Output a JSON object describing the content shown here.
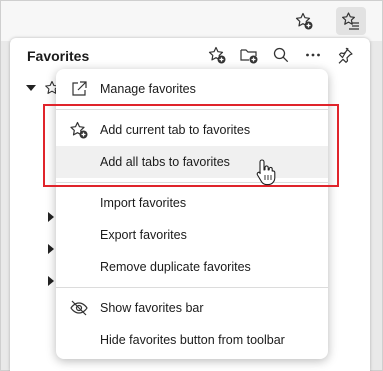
{
  "panel": {
    "title": "Favorites"
  },
  "menu": {
    "items": [
      {
        "label": "Manage favorites",
        "icon": "external-link-icon"
      },
      {
        "label": "Add current tab to favorites",
        "icon": "star-add-icon"
      },
      {
        "label": "Add all tabs to favorites",
        "icon": ""
      },
      {
        "label": "Import favorites",
        "icon": ""
      },
      {
        "label": "Export favorites",
        "icon": ""
      },
      {
        "label": "Remove duplicate favorites",
        "icon": ""
      },
      {
        "label": "Show favorites bar",
        "icon": "eye-off-icon"
      },
      {
        "label": "Hide favorites button from toolbar",
        "icon": ""
      }
    ]
  },
  "colors": {
    "highlight": "#e0242b",
    "hover": "#f0f0f0",
    "accent_green": "#2e7d32"
  }
}
